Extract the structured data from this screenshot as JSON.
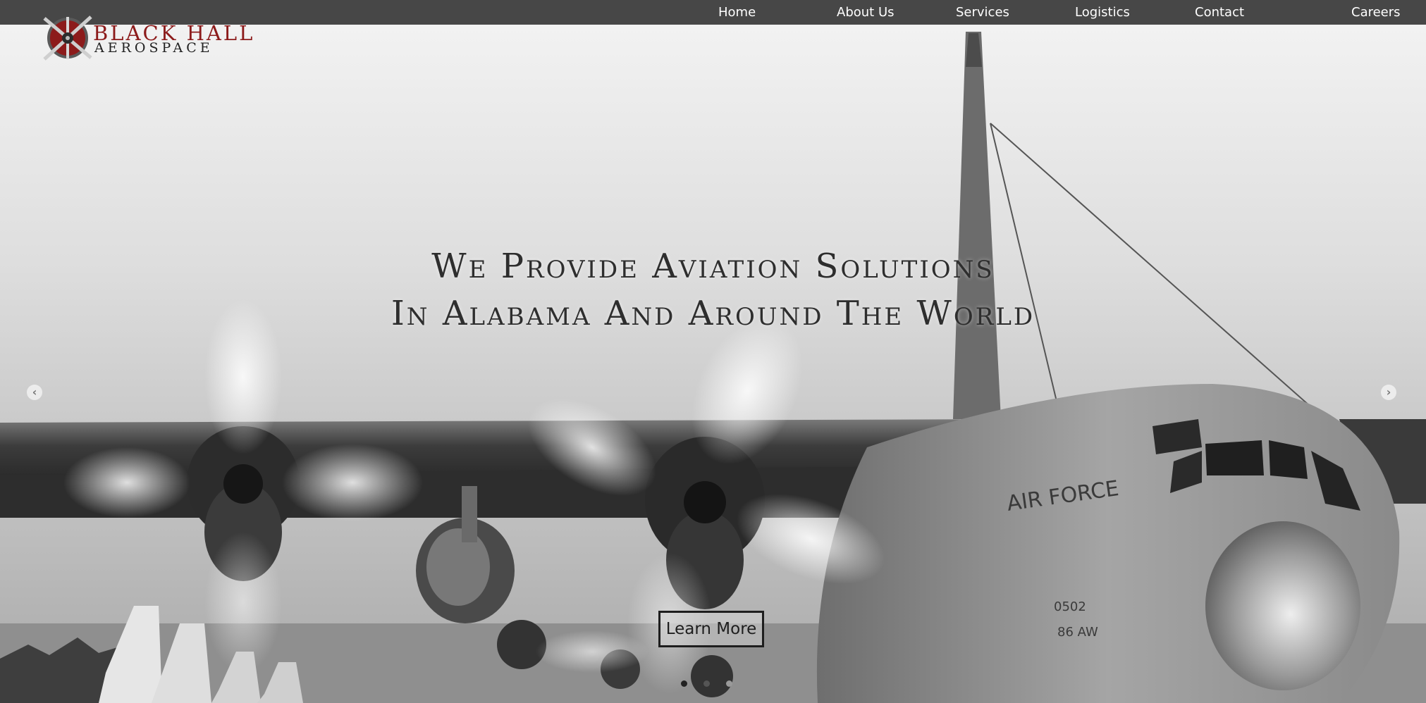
{
  "nav": {
    "items": [
      {
        "label": "Home"
      },
      {
        "label": "About Us"
      },
      {
        "label": "Services"
      },
      {
        "label": "Logistics"
      },
      {
        "label": "Contact"
      },
      {
        "label": "Careers"
      }
    ]
  },
  "logo": {
    "line1": "BLACK HALL",
    "line2": "AEROSPACE",
    "icon": "propeller-emblem"
  },
  "hero": {
    "headline_line1": "We Provide Aviation Solutions",
    "headline_line2": "In Alabama And Around The World",
    "cta_label": "Learn More",
    "prev_icon": "chevron-left-icon",
    "next_icon": "chevron-right-icon",
    "prev_glyph": "‹",
    "next_glyph": "›",
    "slide_count": 3,
    "active_slide": 1,
    "background": "grayscale photo of military transport aircraft with spinning propellers"
  },
  "colors": {
    "navbar": "#474747",
    "brand_red": "#8c1b1b",
    "text_dark": "#2e2e2e"
  }
}
